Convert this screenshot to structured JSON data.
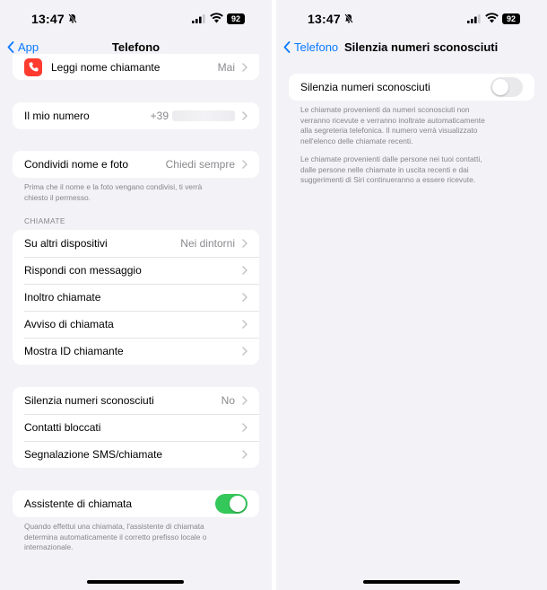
{
  "status": {
    "time": "13:47",
    "battery": "92"
  },
  "left": {
    "back_label": "App",
    "title": "Telefono",
    "top_row": {
      "label": "Leggi nome chiamante",
      "value": "Mai"
    },
    "my_number": {
      "label": "Il mio numero",
      "value": "+39"
    },
    "share": {
      "label": "Condividi nome e foto",
      "value": "Chiedi sempre",
      "footer_lines": [
        "Prima che il nome e la foto vengano condivisi, ti verrà",
        "chiesto il permesso."
      ]
    },
    "calls_header": "CHIAMATE",
    "calls_items": [
      {
        "label": "Su altri dispositivi",
        "value": "Nei dintorni"
      },
      {
        "label": "Rispondi con messaggio",
        "value": ""
      },
      {
        "label": "Inoltro chiamate",
        "value": ""
      },
      {
        "label": "Avviso di chiamata",
        "value": ""
      },
      {
        "label": "Mostra ID chiamante",
        "value": ""
      }
    ],
    "block_items": [
      {
        "label": "Silenzia numeri sconosciuti",
        "value": "No"
      },
      {
        "label": "Contatti bloccati",
        "value": ""
      },
      {
        "label": "Segnalazione SMS/chiamate",
        "value": ""
      }
    ],
    "assistant": {
      "label": "Assistente di chiamata",
      "enabled": true,
      "footer_lines": [
        "Quando effettui una chiamata, l'assistente di chiamata",
        "determina automaticamente il corretto prefisso locale o",
        "internazionale."
      ]
    }
  },
  "right": {
    "back_label": "Telefono",
    "title": "Silenzia numeri sconosciuti",
    "toggle_label": "Silenzia numeri sconosciuti",
    "enabled": false,
    "desc1_lines": [
      "Le chiamate provenienti da numeri sconosciuti non",
      "verranno ricevute e verranno inoltrate automaticamente",
      "alla segreteria telefonica. Il numero verrà visualizzato",
      "nell'elenco delle chiamate recenti."
    ],
    "desc2_lines": [
      "Le chiamate provenienti dalle persone nei tuoi contatti,",
      "dalle persone nelle chiamate in uscita recenti e dai",
      "suggerimenti di Siri continueranno a essere ricevute."
    ]
  },
  "colors": {
    "accent": "#0a7aff",
    "toggle_on": "#34c759",
    "background": "#f2f2f7",
    "secondary_text": "#86868b"
  }
}
